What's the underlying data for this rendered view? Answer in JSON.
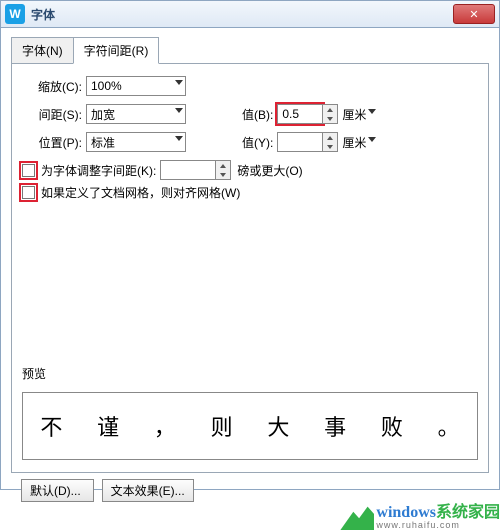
{
  "title": "字体",
  "tabs": {
    "font": "字体(N)",
    "spacing": "字符间距(R)"
  },
  "scale": {
    "label": "缩放(C):",
    "value": "100%"
  },
  "spacing": {
    "label": "间距(S):",
    "value": "加宽"
  },
  "position": {
    "label": "位置(P):",
    "value": "标准"
  },
  "valB": {
    "label": "值(B):",
    "value": "0.5",
    "unit": "厘米"
  },
  "valY": {
    "label": "值(Y):",
    "value": "",
    "unit": "厘米"
  },
  "kerning": {
    "label": "为字体调整字间距(K):",
    "value": "",
    "suffix": "磅或更大(O)"
  },
  "snap": {
    "label": "如果定义了文档网格，则对齐网格(W)"
  },
  "preview": {
    "label": "预览",
    "text": [
      "不",
      "谨",
      "，",
      "则",
      "大",
      "事",
      "败",
      "。"
    ]
  },
  "buttons": {
    "default": "默认(D)...",
    "effects": "文本效果(E)..."
  },
  "watermark": {
    "main": "windows",
    "sub": "系统家园",
    "url": "www.ruhaifu.com"
  }
}
